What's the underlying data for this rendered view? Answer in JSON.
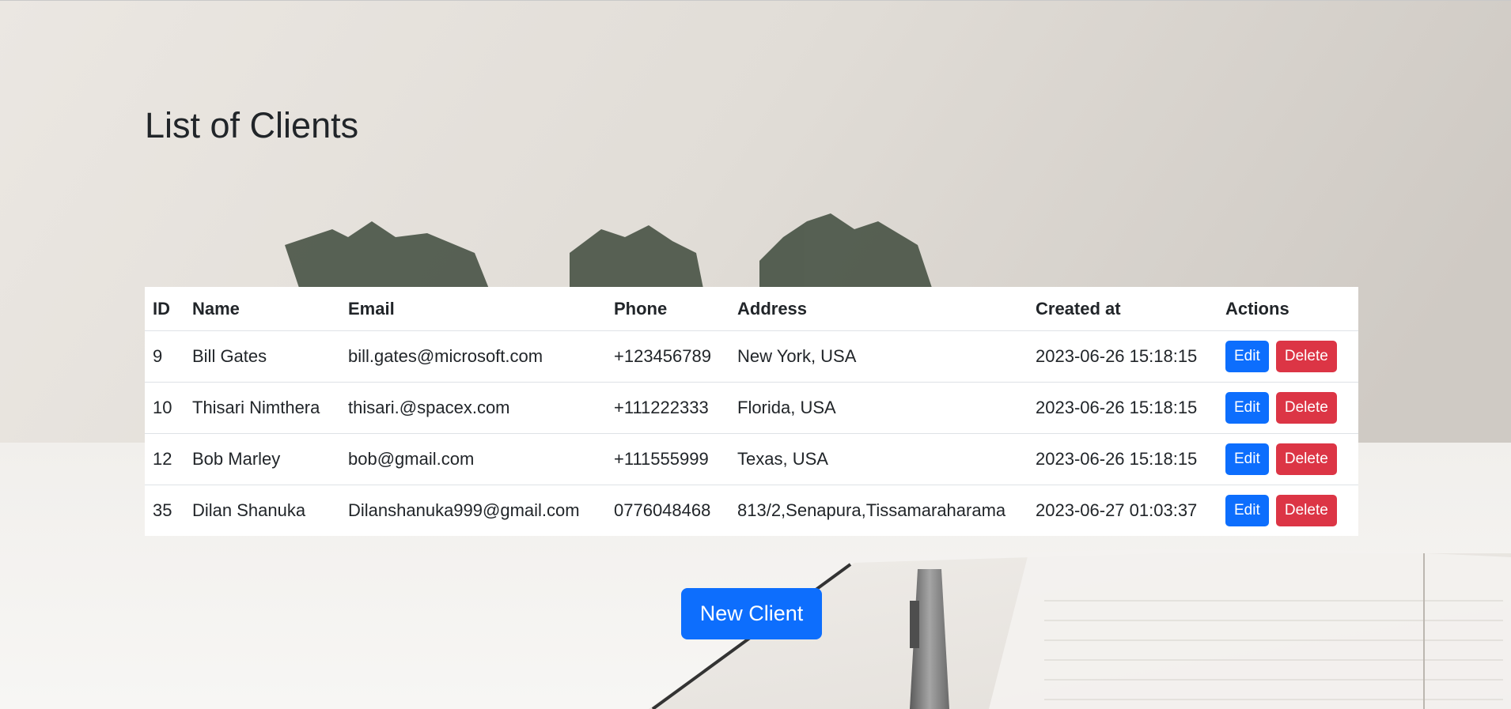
{
  "page": {
    "title": "List of Clients"
  },
  "table": {
    "headers": {
      "id": "ID",
      "name": "Name",
      "email": "Email",
      "phone": "Phone",
      "address": "Address",
      "created_at": "Created at",
      "actions": "Actions"
    },
    "rows": [
      {
        "id": "9",
        "name": "Bill Gates",
        "email": "bill.gates@microsoft.com",
        "phone": "+123456789",
        "address": "New York, USA",
        "created_at": "2023-06-26 15:18:15",
        "edit_label": "Edit",
        "delete_label": "Delete"
      },
      {
        "id": "10",
        "name": "Thisari Nimthera",
        "email": "thisari.@spacex.com",
        "phone": "+111222333",
        "address": "Florida, USA",
        "created_at": "2023-06-26 15:18:15",
        "edit_label": "Edit",
        "delete_label": "Delete"
      },
      {
        "id": "12",
        "name": "Bob Marley",
        "email": "bob@gmail.com",
        "phone": "+111555999",
        "address": "Texas, USA",
        "created_at": "2023-06-26 15:18:15",
        "edit_label": "Edit",
        "delete_label": "Delete"
      },
      {
        "id": "35",
        "name": "Dilan Shanuka",
        "email": "Dilanshanuka999@gmail.com",
        "phone": "0776048468",
        "address": "813/2,Senapura,Tissamaraharama",
        "created_at": "2023-06-27 01:03:37",
        "edit_label": "Edit",
        "delete_label": "Delete"
      }
    ]
  },
  "actions": {
    "new_client_label": "New Client"
  },
  "colors": {
    "primary": "#0d6efd",
    "danger": "#dc3545",
    "text": "#212529",
    "table_bg": "#ffffff"
  }
}
